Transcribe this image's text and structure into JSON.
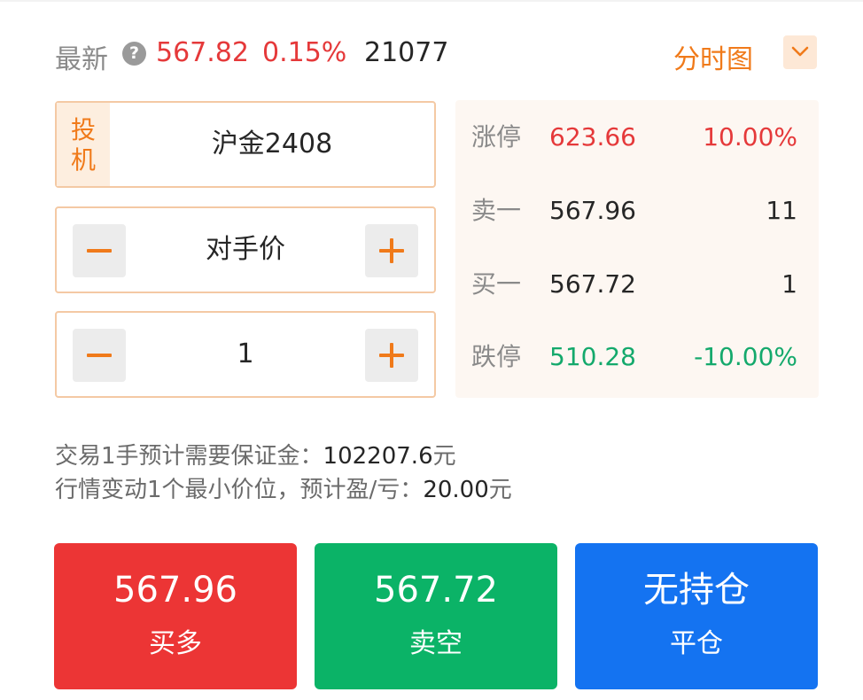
{
  "header": {
    "latest_label": "最新",
    "help_icon": "?",
    "last_price": "567.82",
    "change_pct": "0.15%",
    "volume": "21077",
    "chart_mode": "分时图"
  },
  "order_form": {
    "type_tag": [
      "投",
      "机"
    ],
    "contract": "沪金2408",
    "price_type": "对手价",
    "quantity": "1"
  },
  "quote": {
    "rows": [
      {
        "label": "涨停",
        "price": "623.66",
        "right": "10.00%"
      },
      {
        "label": "卖一",
        "price": "567.96",
        "right": "11"
      },
      {
        "label": "买一",
        "price": "567.72",
        "right": "1"
      },
      {
        "label": "跌停",
        "price": "510.28",
        "right": "-10.00%"
      }
    ]
  },
  "info": {
    "margin_label": "交易1手预计需要保证金：",
    "margin_value": "102207.6",
    "margin_unit": "元",
    "tick_label": "行情变动1个最小价位，预计盈/亏：",
    "tick_value": "20.00",
    "tick_unit": "元"
  },
  "actions": {
    "buy": {
      "price": "567.96",
      "label": "买多"
    },
    "sell": {
      "price": "567.72",
      "label": "卖空"
    },
    "close": {
      "price": "无持仓",
      "label": "平仓"
    }
  },
  "colors": {
    "up": "#e5393a",
    "down": "#14a96c",
    "accent": "#f07a1a",
    "buy": "#ec3535",
    "sell": "#0bb367",
    "close": "#1473f1"
  }
}
